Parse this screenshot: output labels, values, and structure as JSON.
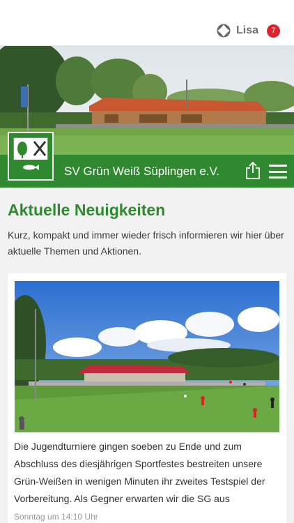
{
  "header": {
    "user_name": "Lisa",
    "notification_count": "7",
    "logo_icon": "club-app-logo-icon"
  },
  "club": {
    "name": "SV Grün Weiß Süplingen e.V.",
    "crest_icon": "club-crest-icon",
    "share_icon": "share-icon",
    "menu_icon": "menu-icon"
  },
  "colors": {
    "brand_green": "#2f8a2f",
    "badge_red": "#e0232b"
  },
  "news": {
    "title": "Aktuelle Neuigkeiten",
    "intro": "Kurz, kompakt und immer wieder frisch informieren wir hier über aktuelle Themen und Aktionen.",
    "articles": [
      {
        "image": "football-field-tournament-photo",
        "text": "Die Jugendturniere gingen soeben zu Ende und zum Abschluss des diesjährigen Sportfestes bestreiten unsere Grün-Weißen in wenigen Minuten ihr zweites Testspiel der Vorbereitung. Als Gegner erwarten wir die SG aus",
        "date": "Sonntag um 14:10 Uhr"
      }
    ]
  }
}
